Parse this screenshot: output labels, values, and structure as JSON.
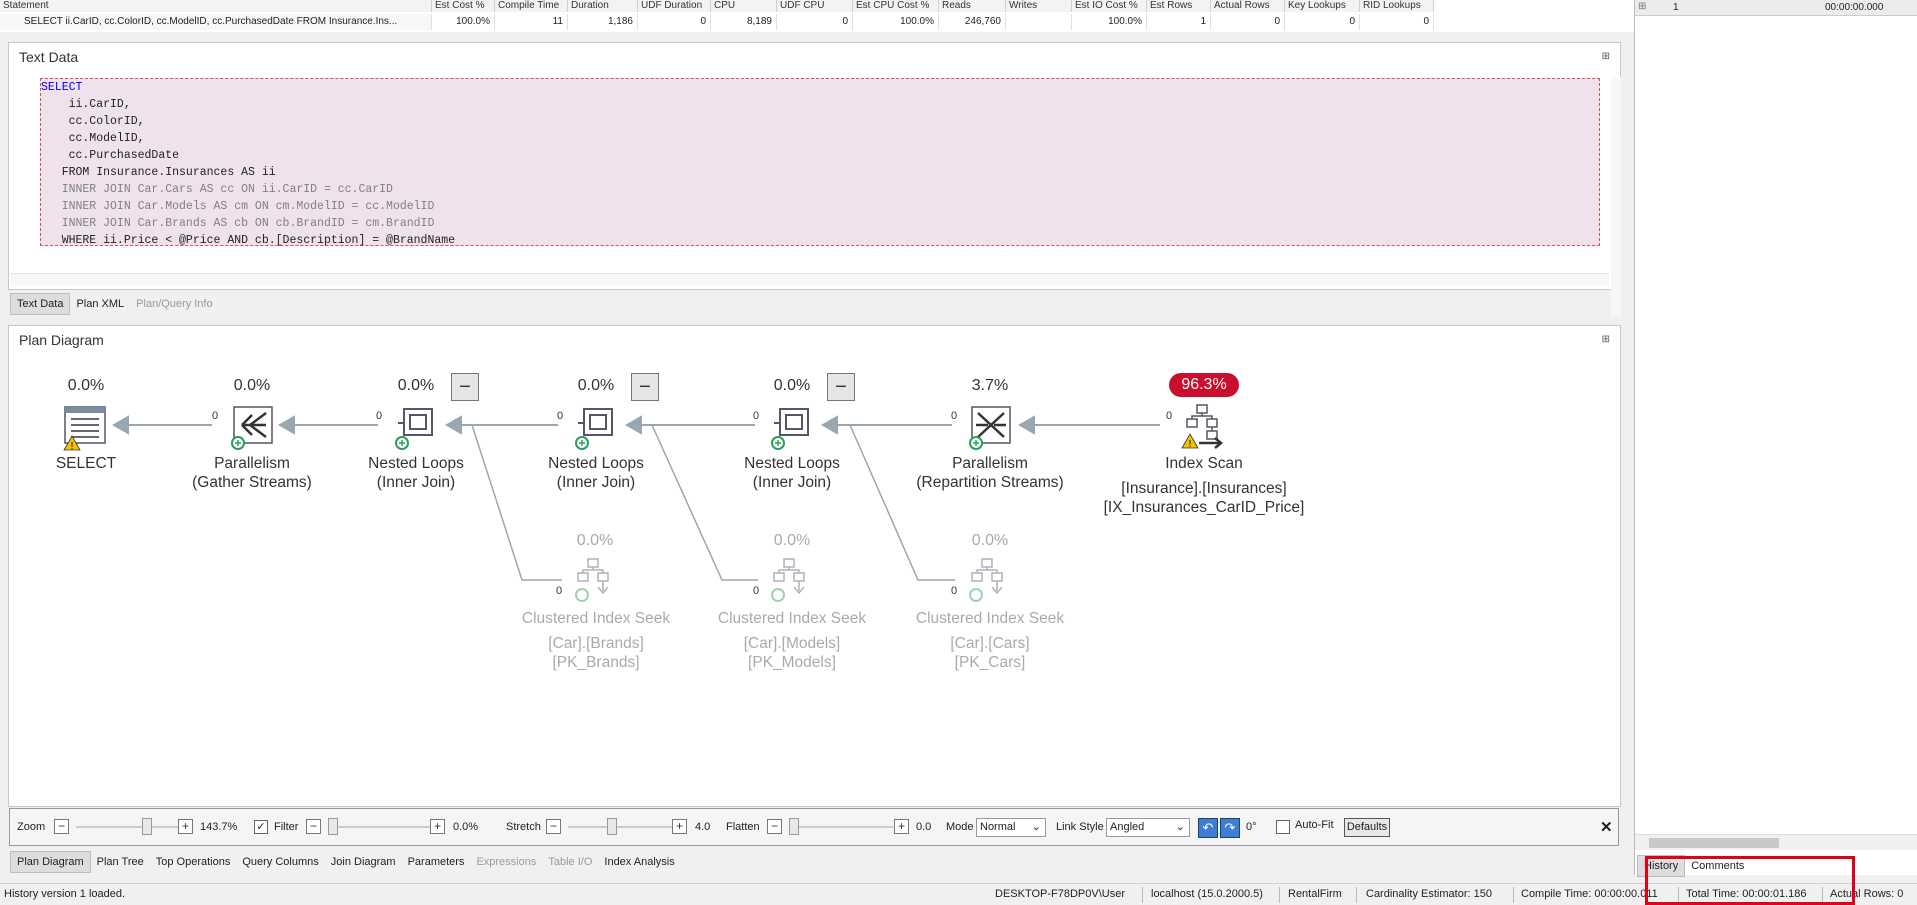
{
  "statements": {
    "headers": [
      "Statement",
      "Est Cost %",
      "Compile Time",
      "Duration",
      "UDF Duration",
      "CPU",
      "UDF CPU",
      "Est CPU Cost %",
      "Reads",
      "Writes",
      "Est IO Cost %",
      "Est Rows",
      "Actual Rows",
      "Key Lookups",
      "RID Lookups"
    ],
    "row": [
      "SELECT ii.CarID, cc.ColorID, cc.ModelID, cc.PurchasedDate FROM Insurance.Ins...",
      "100.0%",
      "11",
      "1,186",
      "0",
      "8,189",
      "0",
      "100.0%",
      "246,760",
      "",
      "100.0%",
      "1",
      "0",
      "0",
      "0"
    ]
  },
  "text_panel": {
    "title": "Text Data",
    "pin_glyph": "⊞",
    "tabs": [
      "Text Data",
      "Plan XML",
      "Plan/Query Info"
    ],
    "code": [
      "SELECT",
      "    ii.CarID,",
      "    cc.ColorID,",
      "    cc.ModelID,",
      "    cc.PurchasedDate",
      "   FROM Insurance.Insurances AS ii",
      "   INNER JOIN Car.Cars AS cc ON ii.CarID = cc.CarID",
      "   INNER JOIN Car.Models AS cm ON cm.ModelID = cc.ModelID",
      "   INNER JOIN Car.Brands AS cb ON cb.BrandID = cm.BrandID",
      "   WHERE ii.Price < @Price AND cb.[Description] = @BrandName"
    ]
  },
  "diagram": {
    "title": "Plan Diagram",
    "nodes": [
      {
        "pct": "0.0%",
        "name": "SELECT",
        "sub": "",
        "sub2": "",
        "rows": ""
      },
      {
        "pct": "0.0%",
        "name": "Parallelism",
        "sub": "(Gather Streams)",
        "sub2": "",
        "rows": "0"
      },
      {
        "pct": "0.0%",
        "name": "Nested Loops",
        "sub": "(Inner Join)",
        "sub2": "",
        "rows": "0"
      },
      {
        "pct": "0.0%",
        "name": "Nested Loops",
        "sub": "(Inner Join)",
        "sub2": "",
        "rows": "0"
      },
      {
        "pct": "0.0%",
        "name": "Nested Loops",
        "sub": "(Inner Join)",
        "sub2": "",
        "rows": "0"
      },
      {
        "pct": "3.7%",
        "name": "Parallelism",
        "sub": "(Repartition Streams)",
        "sub2": "",
        "rows": "0"
      },
      {
        "pct": "96.3%",
        "name": "Index Scan",
        "sub": "[Insurance].[Insurances]",
        "sub2": "[IX_Insurances_CarID_Price]",
        "rows": "0"
      },
      {
        "pct": "0.0%",
        "name": "Clustered Index Seek",
        "sub": "[Car].[Brands]",
        "sub2": "[PK_Brands]",
        "rows": "0"
      },
      {
        "pct": "0.0%",
        "name": "Clustered Index Seek",
        "sub": "[Car].[Models]",
        "sub2": "[PK_Models]",
        "rows": "0"
      },
      {
        "pct": "0.0%",
        "name": "Clustered Index Seek",
        "sub": "[Car].[Cars]",
        "sub2": "[PK_Cars]",
        "rows": "0"
      }
    ],
    "collapse_glyph": "−"
  },
  "toolbar": {
    "zoom_label": "Zoom",
    "zoom_value": "143.7%",
    "filter_label": "Filter",
    "filter_value": "0.0%",
    "filter_checked": "✓",
    "stretch_label": "Stretch",
    "stretch_value": "4.0",
    "flatten_label": "Flatten",
    "flatten_value": "0.0",
    "mode_label": "Mode",
    "mode_value": "Normal",
    "link_style_label": "Link Style",
    "link_style_value": "Angled",
    "rotation_value": "0°",
    "autofit_label": "Auto-Fit",
    "defaults_label": "Defaults",
    "minus": "−",
    "plus": "+",
    "close": "✕"
  },
  "bottom_tabs": [
    "Plan Diagram",
    "Plan Tree",
    "Top Operations",
    "Query Columns",
    "Join Diagram",
    "Parameters",
    "Expressions",
    "Table I/O",
    "Index Analysis"
  ],
  "right_pane": {
    "row_num": "1",
    "row_time": "00:00:00.000",
    "tabs": [
      "History",
      "Comments"
    ]
  },
  "status": {
    "message": "History version 1 loaded.",
    "user": "DESKTOP-F78DP0V\\User",
    "server": "localhost (15.0.2000.5)",
    "database": "RentalFirm",
    "ce": "Cardinality Estimator: 150",
    "compile": "Compile Time: 00:00:00.011",
    "total": "Total Time: 00:00:01.186",
    "actual": "Actual Rows: 0"
  },
  "colors": {
    "highlight_box": "#e0001b",
    "badge": "#c8102e",
    "code_bg": "#efe2ec"
  }
}
